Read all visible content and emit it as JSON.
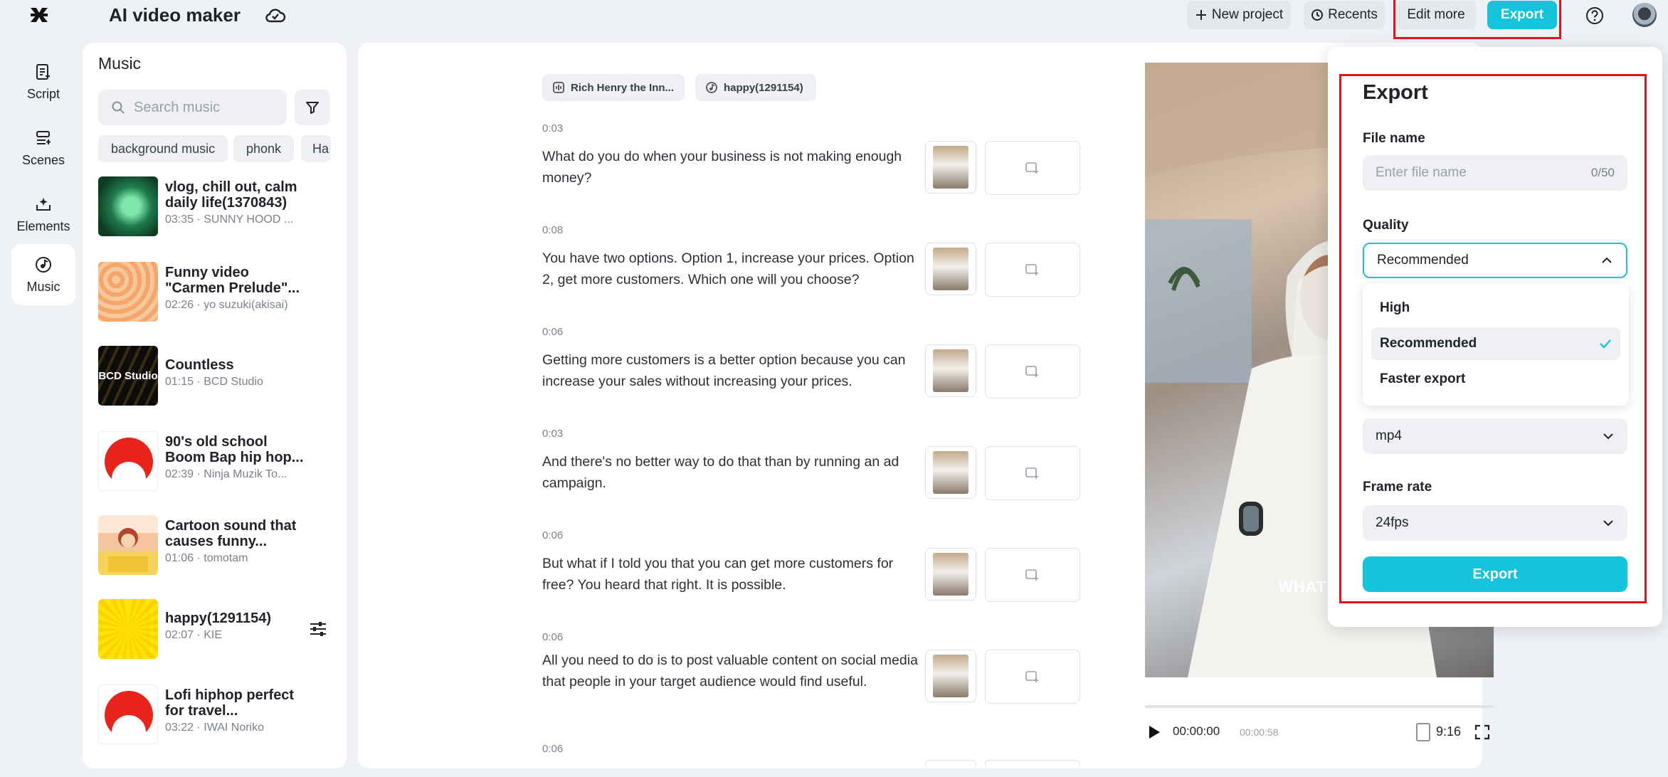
{
  "app": {
    "title": "AI video maker"
  },
  "toolbar": {
    "new_project": "New project",
    "recents": "Recents",
    "edit_more": "Edit more",
    "export": "Export"
  },
  "nav": [
    {
      "label": "Script",
      "icon": "script-icon"
    },
    {
      "label": "Scenes",
      "icon": "scenes-icon"
    },
    {
      "label": "Elements",
      "icon": "elements-icon"
    },
    {
      "label": "Music",
      "icon": "music-icon",
      "active": true
    }
  ],
  "music": {
    "title": "Music",
    "search_placeholder": "Search music",
    "chips": [
      "background music",
      "phonk",
      "Ha"
    ],
    "tracks": [
      {
        "name": "vlog, chill out, calm daily life(1370843)",
        "meta": "03:35 · SUNNY HOOD ..."
      },
      {
        "name": "Funny video \"Carmen Prelude\"...",
        "meta": "02:26 · yo suzuki(akisai)"
      },
      {
        "name": "Countless",
        "meta": "01:15 · BCD Studio",
        "thumb_text": "BCD Studio"
      },
      {
        "name": "90's old school Boom Bap hip hop...",
        "meta": "02:39 · Ninja Muzik To..."
      },
      {
        "name": "Cartoon sound that causes funny...",
        "meta": "01:06 · tomotam"
      },
      {
        "name": "happy(1291154)",
        "meta": "02:07 · KIE"
      },
      {
        "name": "Lofi hiphop perfect for travel...",
        "meta": "03:22 · IWAI Noriko"
      }
    ]
  },
  "script": {
    "tags": [
      "Rich Henry the Inn...",
      "happy(1291154)"
    ],
    "segments": [
      {
        "time": "0:03",
        "text": "What do you do when your business is not making enough money?"
      },
      {
        "time": "0:08",
        "text": "You have two options. Option 1, increase your prices. Option 2, get more customers. Which one will you choose?"
      },
      {
        "time": "0:06",
        "text": "Getting more customers is a better option because you can increase your sales without increasing your prices."
      },
      {
        "time": "0:03",
        "text": "And there's no better way to do that than by running an ad campaign."
      },
      {
        "time": "0:06",
        "text": "But what if I told you that you can get more customers for free? You heard that right. It is possible."
      },
      {
        "time": "0:06",
        "text": "All you need to do is to post valuable content on social media that people in your target audience would find useful."
      },
      {
        "time": "0:06",
        "text": ""
      }
    ]
  },
  "preview": {
    "caption": "WHAT D",
    "current_time": "00:00:00",
    "total_time": "00:00:58",
    "ratio": "9:16"
  },
  "export_panel": {
    "title": "Export",
    "file_name_label": "File name",
    "file_name_placeholder": "Enter file name",
    "file_name_count": "0/50",
    "quality_label": "Quality",
    "quality_value": "Recommended",
    "quality_options": [
      "High",
      "Recommended",
      "Faster export"
    ],
    "format_value": "mp4",
    "frame_rate_label": "Frame rate",
    "frame_rate_value": "24fps",
    "export_button": "Export"
  },
  "colors": {
    "accent": "#14c3dc",
    "highlight_box": "#e0151b"
  }
}
